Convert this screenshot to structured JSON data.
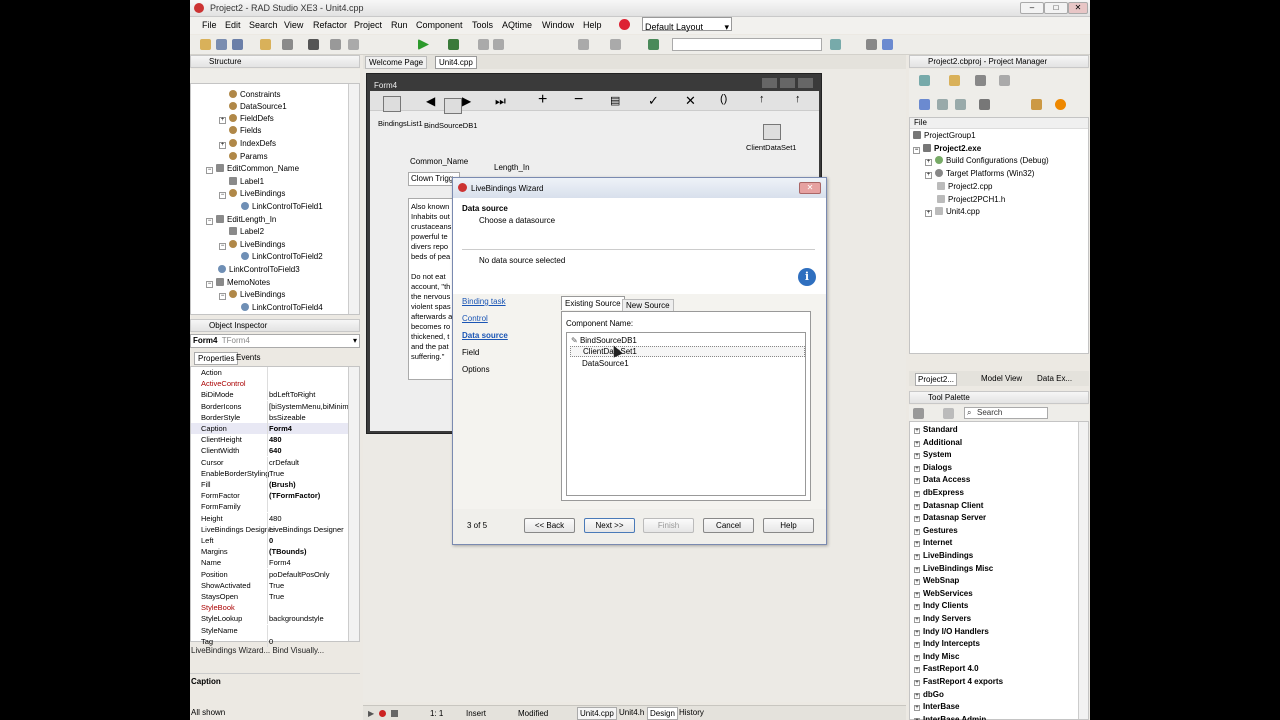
{
  "window": {
    "title": "Project2 - RAD Studio XE3 - Unit4.cpp"
  },
  "menu": [
    "File",
    "Edit",
    "Search",
    "View",
    "Refactor",
    "Project",
    "Run",
    "Component",
    "Tools",
    "AQtime",
    "Window",
    "Help"
  ],
  "layout_select": "Default Layout",
  "editor_tabs": [
    "Welcome Page",
    "Unit4.cpp"
  ],
  "structure": {
    "title": "Structure",
    "items": [
      "Constraints",
      "DataSource1",
      "FieldDefs",
      "Fields",
      "IndexDefs",
      "Params",
      "EditCommon_Name",
      "Label1",
      "LiveBindings",
      "LinkControlToField1",
      "EditLength_In",
      "Label2",
      "LiveBindings",
      "LinkControlToField2",
      "LinkControlToField3",
      "MemoNotes",
      "LiveBindings",
      "LinkControlToField4"
    ]
  },
  "object_inspector": {
    "title": "Object Inspector",
    "selected": "Form4",
    "selected_type": "TForm4",
    "tabs": [
      "Properties",
      "Events"
    ],
    "rows": [
      [
        "Action",
        ""
      ],
      [
        "ActiveControl",
        ""
      ],
      [
        "BiDiMode",
        "bdLeftToRight"
      ],
      [
        "BorderIcons",
        "[biSystemMenu,biMinim"
      ],
      [
        "BorderStyle",
        "bsSizeable"
      ],
      [
        "Caption",
        "Form4"
      ],
      [
        "ClientHeight",
        "480"
      ],
      [
        "ClientWidth",
        "640"
      ],
      [
        "Cursor",
        "crDefault"
      ],
      [
        "EnableBorderStyling",
        "True"
      ],
      [
        "Fill",
        "(Brush)"
      ],
      [
        "FormFactor",
        "(TFormFactor)"
      ],
      [
        "FormFamily",
        ""
      ],
      [
        "Height",
        "480"
      ],
      [
        "LiveBindings Designer",
        "LiveBindings Designer"
      ],
      [
        "Left",
        "0"
      ],
      [
        "Margins",
        "(TBounds)"
      ],
      [
        "Name",
        "Form4"
      ],
      [
        "Position",
        "poDefaultPosOnly"
      ],
      [
        "ShowActivated",
        "True"
      ],
      [
        "StaysOpen",
        "True"
      ],
      [
        "StyleBook",
        ""
      ],
      [
        "StyleLookup",
        "backgroundstyle"
      ],
      [
        "StyleName",
        ""
      ],
      [
        "Tag",
        "0"
      ]
    ],
    "footer_links": "LiveBindings Wizard... Bind Visually...",
    "description_title": "Caption",
    "status": "All shown"
  },
  "form": {
    "title": "Form4",
    "components": [
      "BindingsList1",
      "BindSourceDB1",
      "ClientDataSet1"
    ],
    "label1": "Common_Name",
    "label2": "Length_In",
    "edit1": "Clown Trigg",
    "memo": [
      "Also known",
      "Inhabits out",
      "crustaceans",
      "powerful te",
      "divers repo",
      "beds of pea",
      "",
      "Do not eat",
      "account, \"th",
      "the nervous",
      "violent spas",
      "afterwards a",
      "becomes ro",
      "thickened, t",
      "and the pat",
      "suffering.\""
    ]
  },
  "wizard": {
    "title": "LiveBindings Wizard",
    "heading": "Data source",
    "subheading": "Choose a datasource",
    "message": "No data source selected",
    "steps": [
      "Binding task",
      "Control",
      "Data source",
      "Field",
      "Options"
    ],
    "tabs": [
      "Existing Source",
      "New Source"
    ],
    "component_label": "Component Name:",
    "list": [
      "BindSourceDB1",
      "ClientDataSet1",
      "DataSource1"
    ],
    "page": "3 of 5",
    "buttons": {
      "back": "<< Back",
      "next": "Next >>",
      "finish": "Finish",
      "cancel": "Cancel",
      "help": "Help"
    }
  },
  "status_bar": {
    "pos": "1: 1",
    "mode": "Insert",
    "state": "Modified",
    "tabs": [
      "Unit4.cpp",
      "Unit4.h",
      "Design",
      "History"
    ]
  },
  "project_manager": {
    "title": "Project2.cbproj - Project Manager",
    "file_label": "File",
    "tree": [
      "ProjectGroup1",
      "Project2.exe",
      "Build Configurations (Debug)",
      "Target Platforms (Win32)",
      "Project2.cpp",
      "Project2PCH1.h",
      "Unit4.cpp"
    ],
    "bottom_tabs": [
      "Project2...",
      "Model View",
      "Data Ex..."
    ]
  },
  "tool_palette": {
    "title": "Tool Palette",
    "search_placeholder": "Search",
    "categories": [
      "Standard",
      "Additional",
      "System",
      "Dialogs",
      "Data Access",
      "dbExpress",
      "Datasnap Client",
      "Datasnap Server",
      "Gestures",
      "Internet",
      "LiveBindings",
      "LiveBindings Misc",
      "WebSnap",
      "WebServices",
      "Indy Clients",
      "Indy Servers",
      "Indy I/O Handlers",
      "Indy Intercepts",
      "Indy Misc",
      "FastReport 4.0",
      "FastReport 4 exports",
      "dbGo",
      "InterBase",
      "InterBase Admin"
    ]
  }
}
